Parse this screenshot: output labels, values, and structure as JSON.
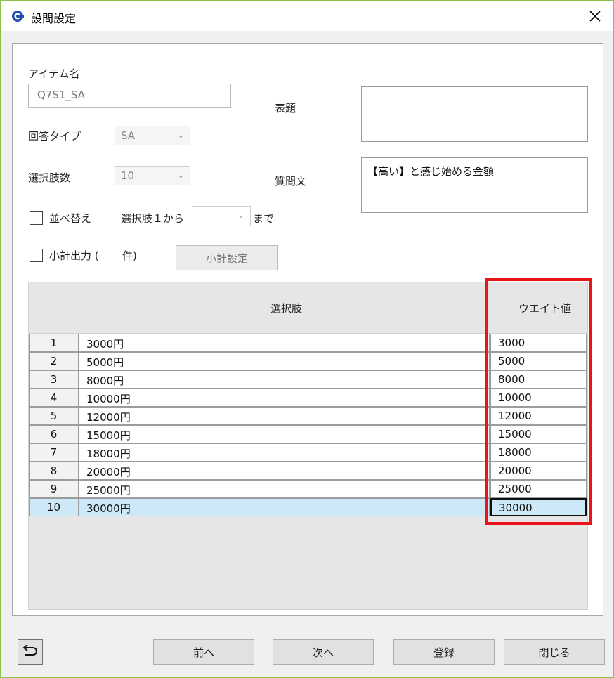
{
  "window": {
    "title": "設問設定"
  },
  "form": {
    "item_name_label": "アイテム名",
    "item_name_value": "Q7S1_SA",
    "answer_type_label": "回答タイプ",
    "answer_type_value": "SA",
    "choice_count_label": "選択肢数",
    "choice_count_value": "10",
    "sort_label": "並べ替え",
    "sort_range_prefix": "選択肢１から",
    "sort_range_suffix": "まで",
    "sort_range_value": "",
    "subtotal_label": "小計出力 (",
    "subtotal_count_suffix": "件)",
    "subtotal_button": "小計設定",
    "heading_label": "表題",
    "heading_value": "",
    "question_label": "質問文",
    "question_value": "【高い】と感じ始める金額"
  },
  "grid": {
    "col_choice": "選択肢",
    "col_weight": "ウエイト値",
    "rows": [
      {
        "no": "1",
        "choice": "3000円",
        "weight": "3000"
      },
      {
        "no": "2",
        "choice": "5000円",
        "weight": "5000"
      },
      {
        "no": "3",
        "choice": "8000円",
        "weight": "8000"
      },
      {
        "no": "4",
        "choice": "10000円",
        "weight": "10000"
      },
      {
        "no": "5",
        "choice": "12000円",
        "weight": "12000"
      },
      {
        "no": "6",
        "choice": "15000円",
        "weight": "15000"
      },
      {
        "no": "7",
        "choice": "18000円",
        "weight": "18000"
      },
      {
        "no": "8",
        "choice": "20000円",
        "weight": "20000"
      },
      {
        "no": "9",
        "choice": "25000円",
        "weight": "25000"
      },
      {
        "no": "10",
        "choice": "30000円",
        "weight": "30000"
      }
    ],
    "selected_row": "10"
  },
  "footer": {
    "prev": "前へ",
    "next": "次へ",
    "register": "登録",
    "close": "閉じる"
  },
  "colors": {
    "highlight": "#e8141a",
    "selected_row": "#cde8f7",
    "window_border": "#8bc34a"
  }
}
